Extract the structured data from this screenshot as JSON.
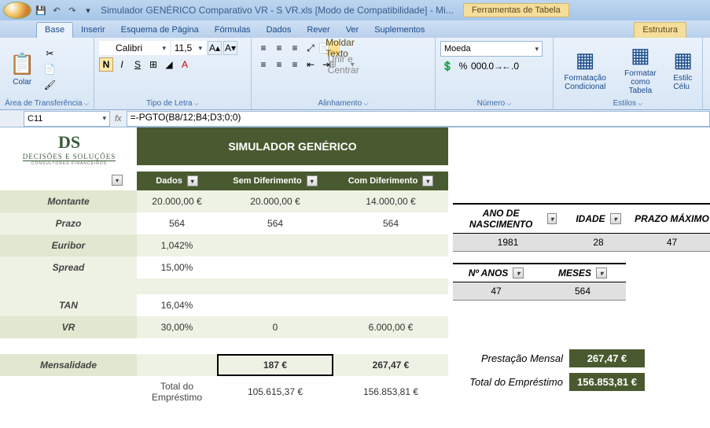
{
  "title": "Simulador GENÉRICO Comparativo VR - S VR.xls  [Modo de Compatibilidade] - Mi...",
  "table_tools": "Ferramentas de Tabela",
  "tabs": {
    "base": "Base",
    "inserir": "Inserir",
    "esquema": "Esquema de Página",
    "formulas": "Fórmulas",
    "dados": "Dados",
    "rever": "Rever",
    "ver": "Ver",
    "suplementos": "Suplementos",
    "estrutura": "Estrutura"
  },
  "ribbon": {
    "clipboard": {
      "colar": "Colar",
      "label": "Área de Transferência"
    },
    "font": {
      "name": "Calibri",
      "size": "11,5",
      "label": "Tipo de Letra"
    },
    "align": {
      "wrap": "Moldar Texto",
      "merge": "Unir e Centrar",
      "label": "Alinhamento"
    },
    "number": {
      "format": "Moeda",
      "label": "Número"
    },
    "styles": {
      "cond": "Formatação Condicional",
      "table": "Formatar como Tabela",
      "cell": "Estilc Célu",
      "label": "Estilos"
    }
  },
  "namebox": "C11",
  "formula": "=-PGTO(B8/12;B4;D3;0;0)",
  "logo": {
    "brand": "DECISÕES E SOLUÇÕES",
    "tag": "CONSULTORES FINANCEIROS"
  },
  "header_band": "SIMULADOR GENÉRICO",
  "cols": {
    "dados": "Dados",
    "sem": "Sem Diferimento",
    "com": "Com Diferimento"
  },
  "rows": {
    "montante": {
      "label": "Montante",
      "dados": "20.000,00 €",
      "sem": "20.000,00 €",
      "com": "14.000,00 €"
    },
    "prazo": {
      "label": "Prazo",
      "dados": "564",
      "sem": "564",
      "com": "564"
    },
    "euribor": {
      "label": "Euribor",
      "dados": "1,042%"
    },
    "spread": {
      "label": "Spread",
      "dados": "15,00%"
    },
    "tan": {
      "label": "TAN",
      "dados": "16,04%"
    },
    "vr": {
      "label": "VR",
      "dados": "30,00%",
      "sem": "0",
      "com": "6.000,00 €"
    },
    "mensalidade": {
      "label": "Mensalidade",
      "sem": "187 €",
      "com": "267,47 €"
    },
    "total": {
      "label": "Total do Empréstimo",
      "sem": "105.615,37 €",
      "com": "156.853,81 €"
    }
  },
  "side1": {
    "ano_label": "ANO DE NASCIMENTO",
    "ano": "1981",
    "idade_label": "IDADE",
    "idade": "28",
    "prazo_label": "PRAZO MÁXIMO",
    "prazo": "47"
  },
  "side2": {
    "anos_label": "Nº ANOS",
    "anos": "47",
    "meses_label": "MESES",
    "meses": "564"
  },
  "summary": {
    "prest_label": "Prestação Mensal",
    "prest": "267,47 €",
    "total_label": "Total do Empréstimo",
    "total": "156.853,81 €"
  }
}
